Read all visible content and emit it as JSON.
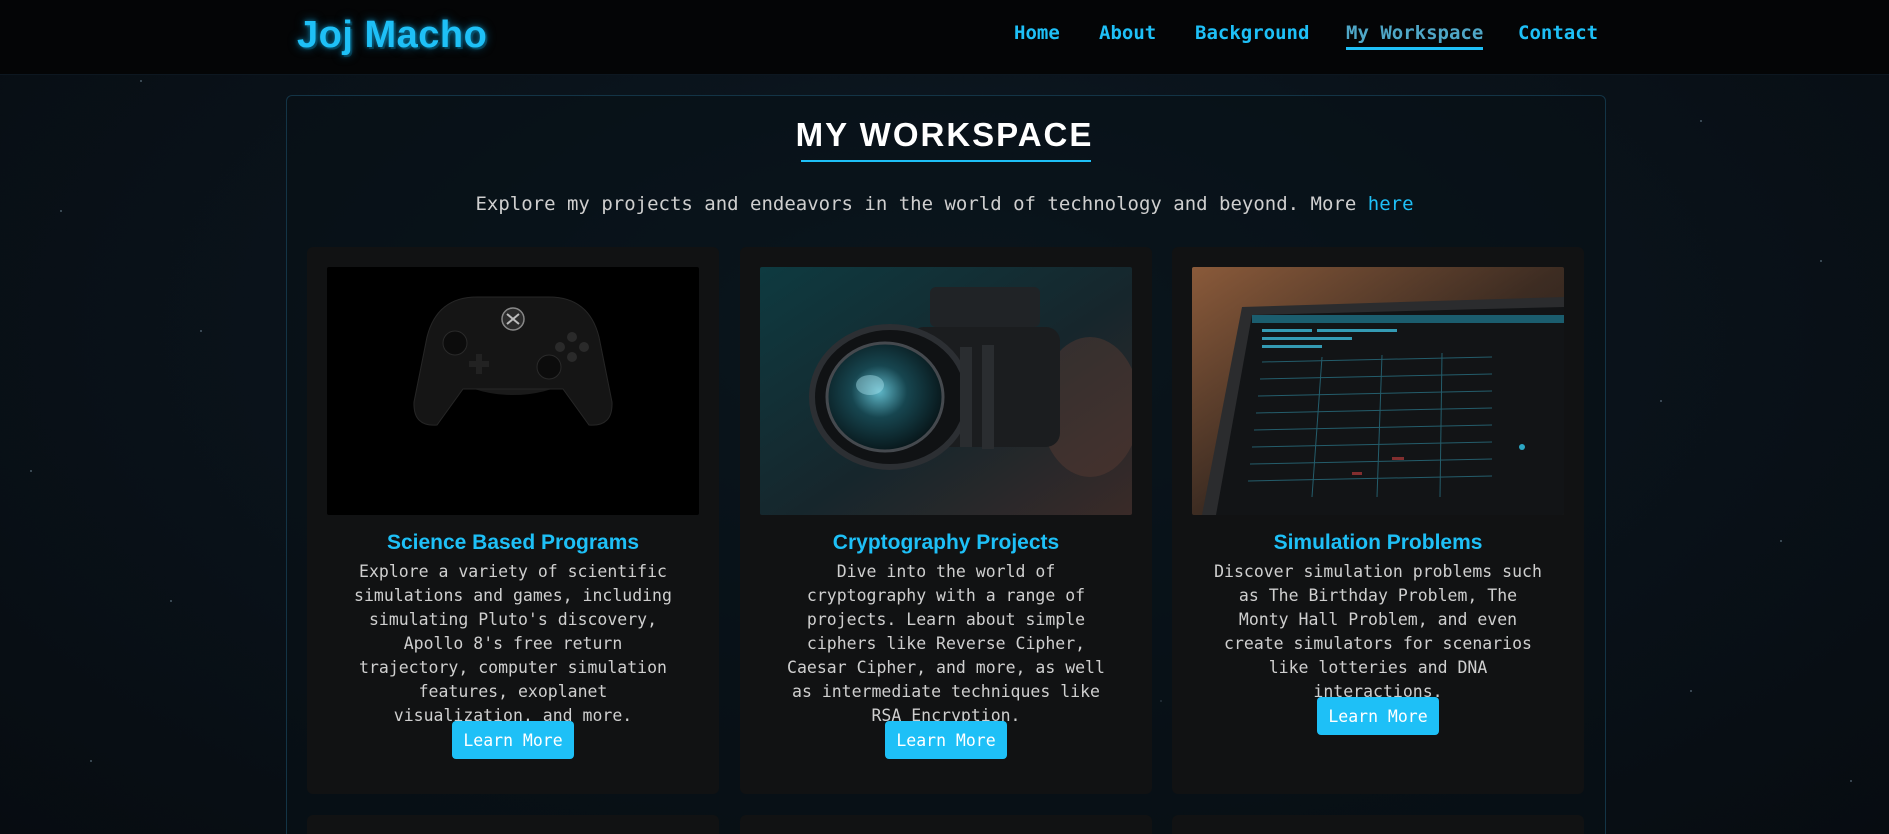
{
  "site": {
    "logo": "Joj Macho"
  },
  "nav": {
    "items": [
      {
        "label": "Home"
      },
      {
        "label": "About"
      },
      {
        "label": "Background"
      },
      {
        "label": "My Workspace",
        "active": true
      },
      {
        "label": "Contact"
      }
    ]
  },
  "main": {
    "title": "MY WORKSPACE",
    "intro_text": "Explore my projects and endeavors in the world of technology and beyond. More",
    "intro_link": "here",
    "cards": [
      {
        "title": "Science Based Programs",
        "description": "Explore a variety of scientific simulations and games, including simulating Pluto's discovery, Apollo 8's free return trajectory, computer simulation features, exoplanet visualization, and more.",
        "button": "Learn More",
        "image": "game-controller-photo"
      },
      {
        "title": "Cryptography Projects",
        "description": "Dive into the world of cryptography with a range of projects. Learn about simple ciphers like Reverse Cipher, Caesar Cipher, and more, as well as intermediate techniques like RSA Encryption.",
        "button": "Learn More",
        "image": "camera-lens-photo"
      },
      {
        "title": "Simulation Problems",
        "description": "Discover simulation problems such as The Birthday Problem, The Monty Hall Problem, and even create simulators for scenarios like lotteries and DNA interactions.",
        "button": "Learn More",
        "image": "laptop-code-photo"
      }
    ]
  },
  "colors": {
    "accent": "#1ec0f7",
    "card_bg": "#111213",
    "nav_bg": "#040506"
  }
}
